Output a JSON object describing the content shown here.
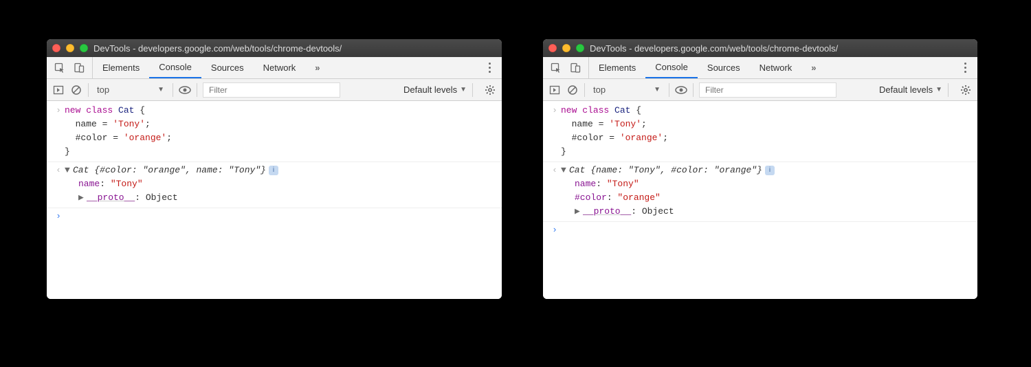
{
  "windows": [
    {
      "title": "DevTools - developers.google.com/web/tools/chrome-devtools/",
      "tabs": [
        "Elements",
        "Console",
        "Sources",
        "Network"
      ],
      "active_tab": "Console",
      "toolbar": {
        "context": "top",
        "levels": "Default levels"
      },
      "filter_placeholder": "Filter",
      "input_code": "new class Cat {\n  name = 'Tony';\n  #color = 'orange';\n}",
      "output": {
        "header_prefix": "Cat ",
        "header_body": "{#color: \"orange\", name: \"Tony\"}",
        "props": [
          {
            "key": "name",
            "val": "\"Tony\"",
            "type": "string"
          }
        ],
        "proto_label": "__proto__",
        "proto_val": "Object"
      }
    },
    {
      "title": "DevTools - developers.google.com/web/tools/chrome-devtools/",
      "tabs": [
        "Elements",
        "Console",
        "Sources",
        "Network"
      ],
      "active_tab": "Console",
      "toolbar": {
        "context": "top",
        "levels": "Default levels"
      },
      "filter_placeholder": "Filter",
      "input_code": "new class Cat {\n  name = 'Tony';\n  #color = 'orange';\n}",
      "output": {
        "header_prefix": "Cat ",
        "header_body": "{name: \"Tony\", #color: \"orange\"}",
        "props": [
          {
            "key": "name",
            "val": "\"Tony\"",
            "type": "string"
          },
          {
            "key": "#color",
            "val": "\"orange\"",
            "type": "string"
          }
        ],
        "proto_label": "__proto__",
        "proto_val": "Object"
      }
    }
  ]
}
